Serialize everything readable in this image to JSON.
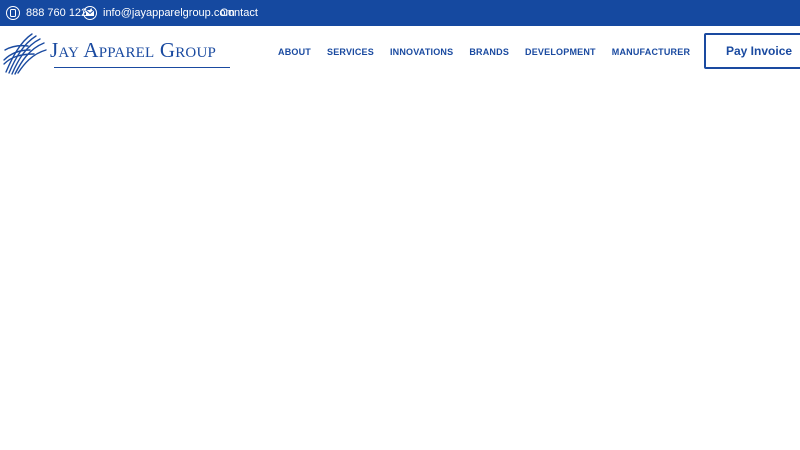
{
  "topbar": {
    "phone": "888 760 1224",
    "email": "info@jayapparelgroup.com",
    "contact": "Contact"
  },
  "logo": {
    "text": "Jay Apparel Group"
  },
  "nav": {
    "items": [
      "ABOUT",
      "SERVICES",
      "INNOVATIONS",
      "BRANDS",
      "DEVELOPMENT",
      "MANUFACTURER"
    ]
  },
  "header": {
    "cta_label": "Pay Invoice"
  },
  "colors": {
    "brand_blue": "#1549a0",
    "nav_text": "#1a4aa0",
    "background": "#ffffff"
  },
  "icons": {
    "phone": "phone-icon",
    "email": "envelope-icon",
    "logo_mark": "wave-lines-logo-icon"
  }
}
